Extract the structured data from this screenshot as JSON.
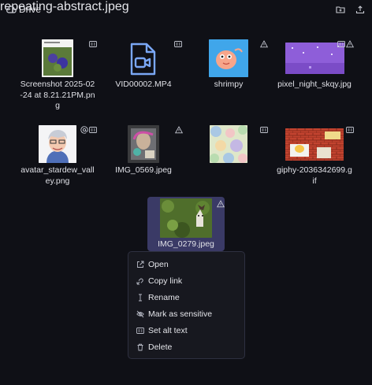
{
  "header": {
    "title": "Drive",
    "icons": [
      "cloud-icon",
      "new-folder-icon",
      "upload-icon"
    ]
  },
  "files": [
    {
      "name": "Screenshot 2025-02-24 at 8.21.21PM.png",
      "badge": "alt-text-icon"
    },
    {
      "name": "VID00002.MP4",
      "badge": "alt-text-icon"
    },
    {
      "name": "shrimpy",
      "badge": "warning-icon"
    },
    {
      "name": "pixel_night_skqy.jpg",
      "badge": "alt-text-icon, warning-icon"
    },
    {
      "name": "avatar_stardew_valley.png",
      "badge": "at-icon, alt-text-icon"
    },
    {
      "name": "IMG_0569.jpeg",
      "badge": "warning-icon"
    },
    {
      "name": "repeating-abstract.jpeg",
      "badge": "alt-text-icon"
    },
    {
      "name": "giphy-2036342699.gif",
      "badge": "alt-text-icon"
    },
    {
      "name": "IMG_0279.jpeg",
      "badge": "warning-icon",
      "selected": true
    }
  ],
  "context_menu": {
    "items": [
      {
        "label": "Open",
        "icon": "external-link-icon"
      },
      {
        "label": "Copy link",
        "icon": "link-icon"
      },
      {
        "label": "Rename",
        "icon": "text-cursor-icon"
      },
      {
        "label": "Mark as sensitive",
        "icon": "eye-off-icon"
      },
      {
        "label": "Set alt text",
        "icon": "alt-text-icon"
      },
      {
        "label": "Delete",
        "icon": "trash-icon"
      }
    ]
  },
  "colors": {
    "background": "#0f1016",
    "selection": "#3a3a66",
    "menu_bg": "#17181f",
    "video_icon": "#7aa7f5"
  }
}
